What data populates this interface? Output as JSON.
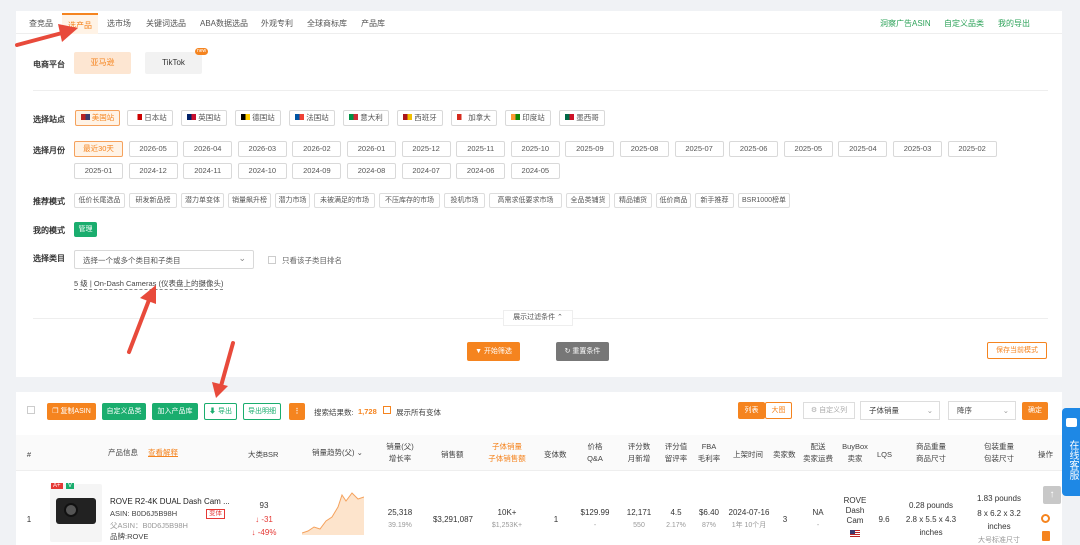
{
  "nav": {
    "tabs": [
      "查竞品",
      "选产品",
      "选市场",
      "关键词选品",
      "ABA数据选品",
      "外观专利",
      "全球商标库",
      "产品库"
    ],
    "active": "选产品",
    "right_links": [
      "洞察广告ASIN",
      "自定义品类",
      "我的导出"
    ]
  },
  "platform": {
    "label": "电商平台",
    "options": [
      "亚马逊",
      "TikTok"
    ],
    "new_badge": "new"
  },
  "site": {
    "label": "选择站点",
    "options": [
      "美国站",
      "日本站",
      "英国站",
      "德国站",
      "法国站",
      "意大利",
      "西班牙",
      "加拿大",
      "印度站",
      "墨西哥"
    ]
  },
  "month": {
    "label": "选择月份",
    "row1": [
      "最近30天",
      "2026-05",
      "2026-04",
      "2026-03",
      "2026-02",
      "2026-01",
      "2025-12",
      "2025-11",
      "2025-10",
      "2025-09",
      "2025-08",
      "2025-07",
      "2025-06",
      "2025-05",
      "2025-04",
      "2025-03",
      "2025-02"
    ],
    "row2": [
      "2025-01",
      "2024-12",
      "2024-11",
      "2024-10",
      "2024-09",
      "2024-08",
      "2024-07",
      "2024-06",
      "2024-05"
    ]
  },
  "recommend": {
    "label": "推荐模式",
    "options": [
      "低价长尾选品",
      "研发新品榜",
      "潜力单变体",
      "销量飙升榜",
      "潜力市场",
      "未被满足的市场",
      "不压库存的市场",
      "投机市场",
      "高需求低要求市场",
      "全品类铺货",
      "精品铺货",
      "低价商品",
      "新手推荐",
      "BSR1000榜单"
    ]
  },
  "mymode": {
    "label": "我的模式",
    "manage": "管理"
  },
  "category": {
    "label": "选择类目",
    "placeholder": "选择一个或多个类目和子类目",
    "only_sub": "只看该子类目排名",
    "selected": "5 级 | On-Dash Cameras (仪表盘上的摄像头)"
  },
  "filter_toggle": "展示过滤条件",
  "actions": {
    "start": "开始筛选",
    "reset": "重置条件",
    "save": "保存当前模式"
  },
  "toolbar": {
    "copy_asin": "复制ASIN",
    "custom_cat": "自定义品类",
    "add_lib": "加入产品库",
    "export": "导出",
    "export_detail": "导出明细",
    "more": "⋮",
    "result_label": "搜索结果数:",
    "result_count": "1,728",
    "show_all": "展示所有变体",
    "view_list": "列表",
    "view_grid": "大图",
    "custom_col": "自定义列",
    "sort_field": "子体销量",
    "sort_order": "降序",
    "confirm": "确定"
  },
  "columns": [
    "#",
    "产品信息",
    "查看解释",
    "大类BSR",
    "销量趋势(父)",
    "销量(父)",
    "增长率",
    "销售额",
    "子体销量",
    "子体销售额",
    "变体数",
    "价格",
    "Q&A",
    "评分数",
    "月新增",
    "评分值",
    "留评率",
    "FBA",
    "毛利率",
    "上架时间",
    "卖家数",
    "配送",
    "卖家运费",
    "BuyBox",
    "卖家",
    "LQS",
    "商品重量",
    "商品尺寸",
    "包装重量",
    "包装尺寸",
    "操作"
  ],
  "rows": [
    {
      "index": "1",
      "badges": [
        "A+",
        "V"
      ],
      "title": "ROVE R2-4K DUAL Dash Cam ...",
      "asin": "ASIN: B0D6J5B98H",
      "tag": "变体",
      "parent": "父ASIN：B0D6J5B98H",
      "brand": "品牌:ROVE",
      "bsr": "93",
      "bsr_change": "↓ -31",
      "bsr_pct": "↓ -49%",
      "sales": "25,318",
      "growth": "39.19%",
      "revenue": "$3,291,087",
      "child_sales": "10K+",
      "child_rev": "$1,253K+",
      "variants": "1",
      "price": "$129.99",
      "qa": "-",
      "ratings": "12,171",
      "new_ratings": "550",
      "score": "4.5",
      "review_rate": "2.17%",
      "fba": "$6.40",
      "margin": "87%",
      "launch": "2024-07-16",
      "age": "1年 10个月",
      "sellers": "3",
      "delivery": "NA",
      "ship_fee": "-",
      "buybox": "ROVE Dash Cam",
      "lqs": "9.6",
      "weight": "0.28 pounds",
      "dims": "2.8 x 5.5 x 4.3 inches",
      "pkg_weight": "1.83 pounds",
      "pkg_dims": "8 x 6.2 x 3.2 inches",
      "pkg_note": "大号标准尺寸"
    }
  ],
  "side_chat": "在线客服",
  "colors": {
    "accent": "#f5841f",
    "green": "#1aad6e",
    "red": "#e53935"
  }
}
